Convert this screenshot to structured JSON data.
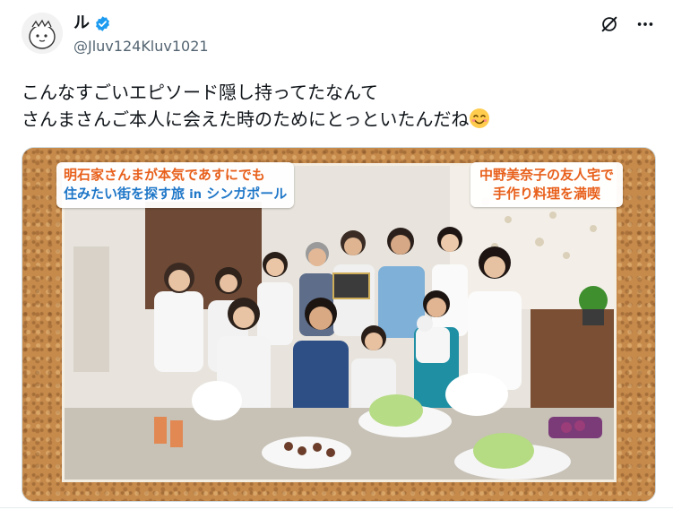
{
  "post": {
    "author": {
      "display_name": "ル",
      "handle": "@Jluv124Kluv1021",
      "verified": true
    },
    "text_lines": [
      "こんなすごいエピソード隠し持ってたなんて",
      "さんまさんご本人に会えた時のためにとっといたんだね"
    ],
    "emoji": "smiling-face-with-smiling-eyes"
  },
  "media": {
    "caption_left": {
      "line1": "明石家さんまが本気であすにでも",
      "line2": "住みたい街を探す旅",
      "line2_suffix": "in",
      "line2_end": "シンガポール"
    },
    "caption_right": {
      "line1": "中野美奈子の友人宅で",
      "line2": "手作り料理を満喫"
    }
  },
  "colors": {
    "accent_blue": "#1d9bf0",
    "caption_orange": "#e8601c",
    "caption_blue": "#1f77c8"
  }
}
